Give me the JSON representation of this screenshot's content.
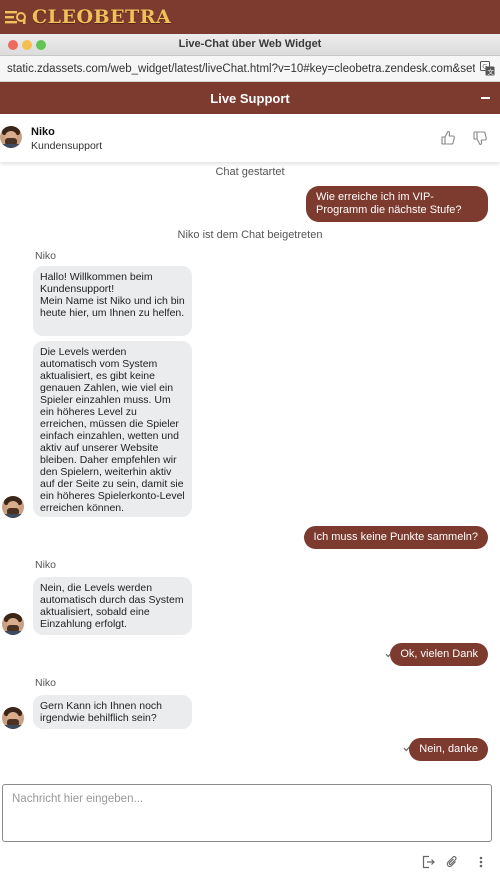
{
  "site": {
    "logo_text": "CLEOBETRA",
    "accent": "#7d3a2e",
    "logo_color": "#f0c05a"
  },
  "window": {
    "title": "Live-Chat über Web Widget"
  },
  "address_bar": {
    "url": "static.zdassets.com/web_widget/latest/liveChat.html?v=10#key=cleobetra.zendesk.com&set…"
  },
  "widget": {
    "title": "Live Support"
  },
  "agent": {
    "name": "Niko",
    "role": "Kundensupport"
  },
  "messages": {
    "chat_started": "Chat gestartet",
    "user1": "Wie erreiche ich im VIP-Programm die nächste Stufe?",
    "agent_joined": "Niko ist dem Chat beigetreten",
    "sender1": "Niko",
    "agent1": "Hallo! Willkommen beim Kundensupport!\nMein Name ist Niko und ich bin heute hier, um Ihnen zu helfen.",
    "agent2": "Die Levels werden automatisch vom System aktualisiert, es gibt keine genauen Zahlen, wie viel ein Spieler einzahlen muss. Um ein höheres Level zu erreichen, müssen die Spieler einfach einzahlen, wetten und aktiv auf unserer Website bleiben. Daher empfehlen wir den Spielern, weiterhin aktiv auf der Seite zu sein, damit sie ein höheres Spielerkonto-Level erreichen können.",
    "user2": "Ich muss keine Punkte sammeln?",
    "sender2": "Niko",
    "agent3": "Nein, die Levels werden automatisch durch das System aktualisiert, sobald eine Einzahlung erfolgt.",
    "user3": "Ok, vielen Dank",
    "sender3": "Niko",
    "agent4": "Gern Kann ich Ihnen noch irgendwie behilflich sein?",
    "user4": "Nein, danke"
  },
  "composer": {
    "placeholder": "Nachricht hier eingeben..."
  },
  "icons": [
    "menu-icon",
    "translate-icon",
    "minimize-icon",
    "thumbs-up-icon",
    "thumbs-down-icon",
    "check-icon",
    "end-chat-icon",
    "attach-icon",
    "menu-dots-icon"
  ]
}
